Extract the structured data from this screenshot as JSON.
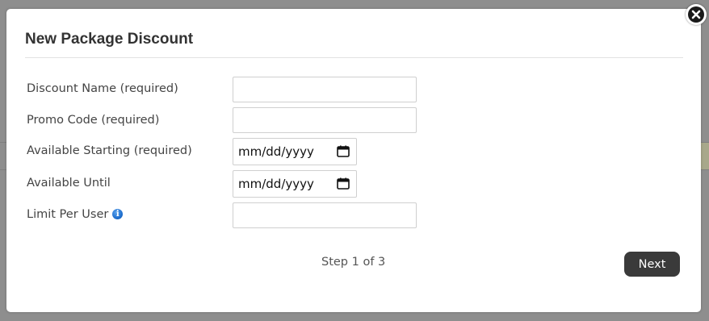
{
  "modal": {
    "title": "New Package Discount",
    "fields": [
      {
        "label": "Discount Name (required)",
        "type": "text",
        "value": ""
      },
      {
        "label": "Promo Code (required)",
        "type": "text",
        "value": ""
      },
      {
        "label": "Available Starting (required)",
        "type": "date",
        "value": "mm/dd/yyyy"
      },
      {
        "label": "Available Until",
        "type": "date",
        "value": "mm/dd/yyyy"
      },
      {
        "label": "Limit Per User",
        "type": "text",
        "value": "",
        "info_icon": "info-icon"
      }
    ],
    "step_text": "Step 1 of 3",
    "next_label": "Next",
    "close_icon": "close-icon"
  },
  "colors": {
    "backdrop": "#8e8e8e",
    "button": "#3a3a3a",
    "info_icon": "#1f6fcf"
  }
}
